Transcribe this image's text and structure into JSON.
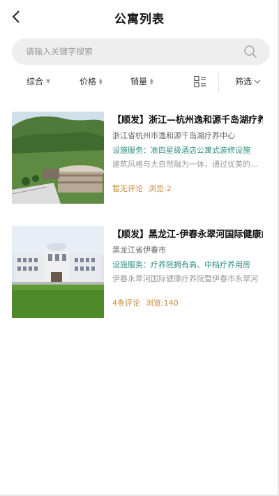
{
  "header": {
    "title": "公寓列表"
  },
  "search": {
    "placeholder": "请输入关键字搜索"
  },
  "filters": {
    "comprehensive": "综合",
    "price": "价格",
    "sales": "销量",
    "screen": "筛选"
  },
  "listings": [
    {
      "title": "【顺发】浙江—杭州逸和源千岛湖疗养中心",
      "address": "浙江省杭州市逸和源千岛湖疗养中心",
      "facilities": "设施服务：准四星级酒店公寓式装修设施",
      "description": "建筑风格与大自然融为一体，通过优美的环境",
      "reviews": "暂无评论",
      "views": "浏览:2"
    },
    {
      "title": "【顺发】黑龙江-伊春永翠河国际健康疗养院",
      "address": "黑龙江省伊春市",
      "facilities": "设施服务：疗养院拥有高、中档疗养用房",
      "description": "伊春永翠河国际健康疗养院暨伊春市永翠河",
      "reviews": "4条评论",
      "views": "浏览:140"
    }
  ],
  "colors": {
    "facility_text": "#2f8f84",
    "stats_text": "#c98a3c",
    "search_bg": "#eeeeee"
  }
}
